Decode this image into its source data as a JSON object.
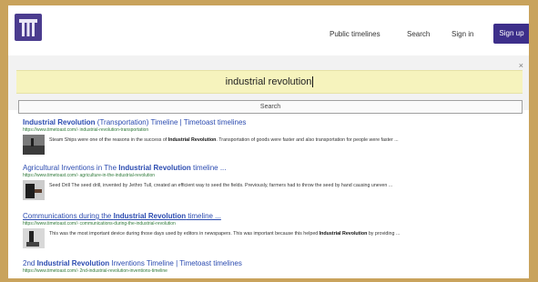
{
  "header": {
    "nav": {
      "public_timelines": "Public timelines",
      "search": "Search",
      "sign_in": "Sign in",
      "sign_up": "Sign up"
    }
  },
  "search": {
    "query": "industrial revolution",
    "button_label": "Search",
    "close_label": "×"
  },
  "results": [
    {
      "title_parts": [
        "Industrial Revolution",
        " (Transportation) Timeline | Timetoast timelines"
      ],
      "url": "https://www.timetoast.com/› industrial-revolution-transportation",
      "snippet_parts": [
        "Steam Ships were one of the reasons in the success of ",
        "Industrial Revolution",
        ". Transportation of goods were faster and also transportation for people were faster ..."
      ]
    },
    {
      "title_parts": [
        "Agricultural Inventions in The ",
        "Industrial Revolution",
        " timeline ..."
      ],
      "url": "https://www.timetoast.com/› agriculture-in-the-industrial-revolution",
      "snippet_parts": [
        "Seed Drill The seed drill, invented by Jethro Tull, created an efficient way to seed the fields. Previously, farmers had to throw the seed by hand causing uneven ...",
        "",
        ""
      ]
    },
    {
      "title_parts": [
        "Communications during the ",
        "Industrial Revolution",
        " timeline ..."
      ],
      "url": "https://www.timetoast.com/› communications-during-the-industrial-revolution",
      "snippet_parts": [
        "This was the most important device during those days used by editors in newspapers. This was important because this helped ",
        "Industrial Revolution",
        " by providing ..."
      ]
    },
    {
      "title_parts": [
        "2nd ",
        "Industrial Revolution",
        " Inventions Timeline | Timetoast timelines"
      ],
      "url": "https://www.timetoast.com/› 2nd-industrial-revolution-inventions-timeline",
      "snippet_parts": [
        "",
        "",
        ""
      ]
    }
  ],
  "colors": {
    "brand": "#4b3c8f",
    "signup": "#3d2f8a",
    "query_bg": "#f6f3bd",
    "link": "#2b4bb0",
    "url": "#2f7a3a"
  }
}
